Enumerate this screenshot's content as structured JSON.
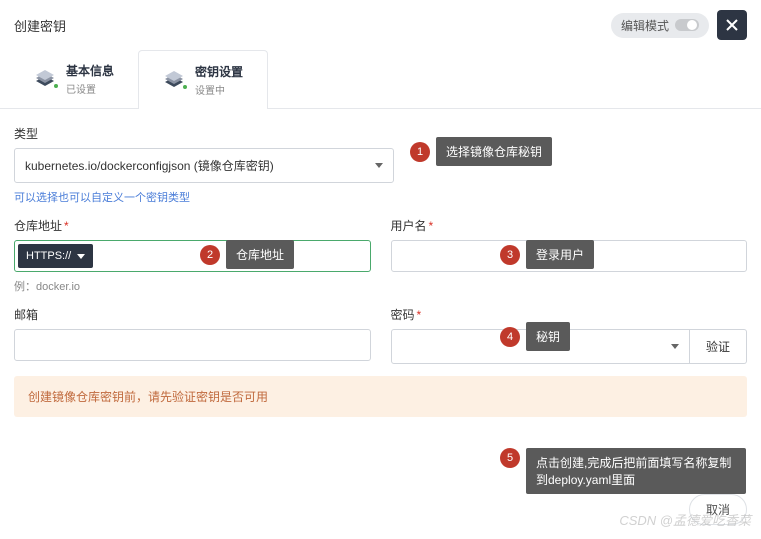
{
  "header": {
    "title": "创建密钥",
    "edit_mode": "编辑模式"
  },
  "tabs": {
    "t1": {
      "label": "基本信息",
      "status": "已设置"
    },
    "t2": {
      "label": "密钥设置",
      "status": "设置中"
    }
  },
  "form": {
    "type": {
      "label": "类型",
      "value": "kubernetes.io/dockerconfigjson (镜像仓库密钥)",
      "hint": "可以选择也可以自定义一个密钥类型"
    },
    "repo": {
      "label": "仓库地址",
      "scheme": "HTTPS://",
      "value": "",
      "example": "例：docker.io"
    },
    "username": {
      "label": "用户名",
      "value": ""
    },
    "email": {
      "label": "邮箱",
      "value": ""
    },
    "password": {
      "label": "密码",
      "verify": "验证"
    }
  },
  "warning": "创建镜像仓库密钥前，请先验证密钥是否可用",
  "annotations": {
    "a1": {
      "num": "1",
      "text": "选择镜像仓库秘钥"
    },
    "a2": {
      "num": "2",
      "text": "仓库地址"
    },
    "a3": {
      "num": "3",
      "text": "登录用户"
    },
    "a4": {
      "num": "4",
      "text": "秘钥"
    },
    "a5": {
      "num": "5",
      "text": "点击创建,完成后把前面填写名称复制到deploy.yaml里面"
    }
  },
  "footer": {
    "cancel": "取消"
  },
  "watermark": "CSDN @孟德爱吃香菜"
}
